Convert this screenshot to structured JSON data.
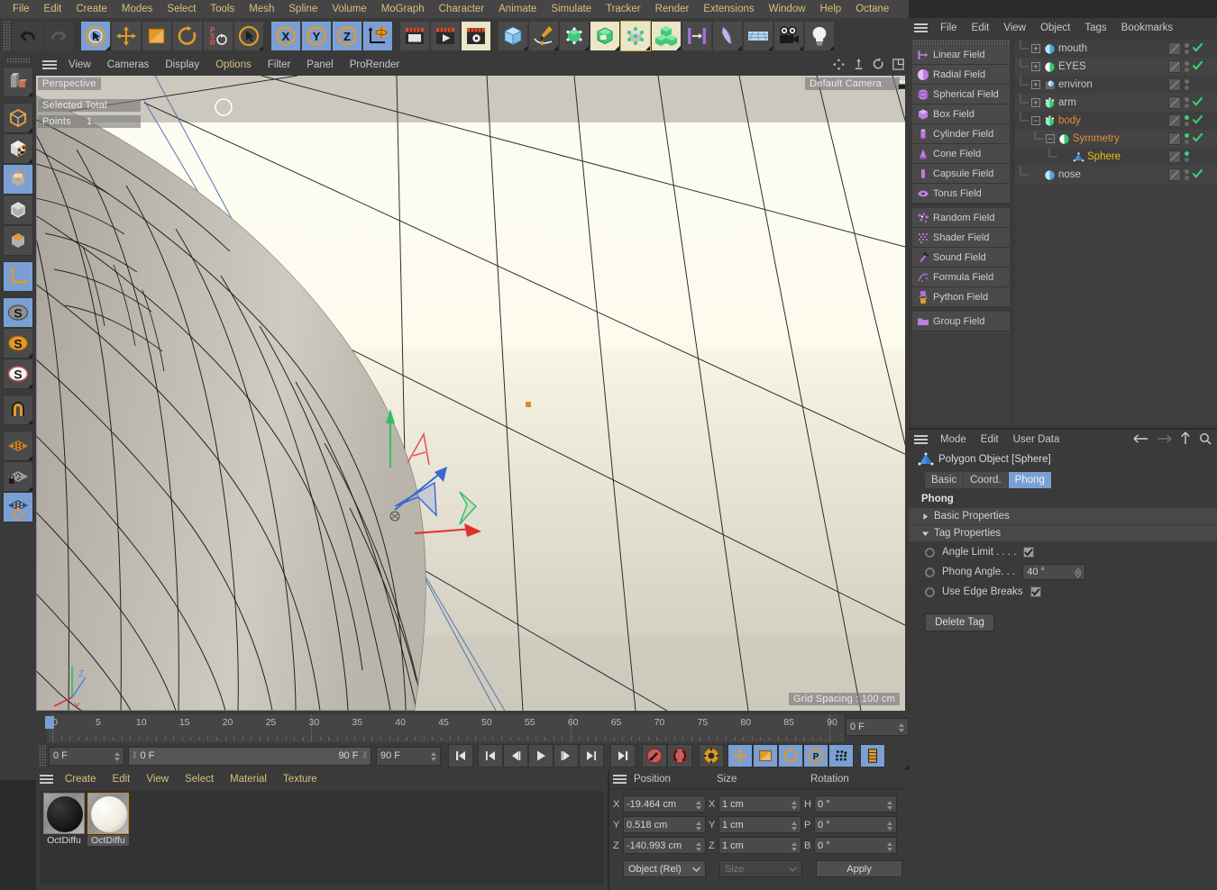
{
  "menubar": {
    "items": [
      "File",
      "Edit",
      "Create",
      "Modes",
      "Select",
      "Tools",
      "Mesh",
      "Spline",
      "Volume",
      "MoGraph",
      "Character",
      "Animate",
      "Simulate",
      "Tracker",
      "Render",
      "Extensions",
      "Window",
      "Help",
      "Octane"
    ]
  },
  "toolbar": {
    "undo": "undo-arrow",
    "redo": "redo-arrow",
    "tools": [
      "select-live-tool",
      "move-tool",
      "scale-tool",
      "rotate-tool",
      "psr-tool",
      "select-mode-tool"
    ],
    "axes": [
      "X",
      "Y",
      "Z"
    ],
    "world_label": "world-axis",
    "render_tools": [
      "render-view",
      "render-picture-viewer",
      "render-settings"
    ],
    "prim_tools": [
      "cube-primitive",
      "pen-spline",
      "subdivision-surface",
      "extrude-generator",
      "deformer",
      "array-cloner",
      "symmetry-tool",
      "bend-deformer",
      "floor-environment",
      "camera",
      "light"
    ]
  },
  "leftbar": {
    "items": [
      "make-editable",
      "model-mode",
      "texture-mode",
      "points-mode",
      "edges-mode",
      "polygons-mode",
      "axis-mode",
      "enable-snap-s1",
      "enable-snap-s2",
      "enable-snap-s3",
      "magnet-tool",
      "workplane",
      "lock-workplane",
      "workplane-rotate"
    ]
  },
  "viewport": {
    "menu": [
      "View",
      "Cameras",
      "Display",
      "Options",
      "Filter",
      "Panel",
      "ProRender"
    ],
    "menu_highlight": "Options",
    "perspective_label": "Perspective",
    "camera_label": "Default Camera",
    "hud_selected_total": "Selected Total",
    "hud_points_label": "Points",
    "hud_points_value": "1",
    "grid_spacing": "Grid Spacing : 100 cm",
    "axis_labels": {
      "x": "X",
      "y": "Y",
      "z": "Z"
    },
    "gizmo_axis_colors": {
      "x": "#e03a3a",
      "y": "#2fcc6e",
      "z": "#3a6fe0"
    },
    "background_top": "#fdfbf0",
    "background_bottom": "#cdc9be",
    "mesh_fill": "#b9b5ad"
  },
  "timeline": {
    "ticks": [
      0,
      5,
      10,
      15,
      20,
      25,
      30,
      35,
      40,
      45,
      50,
      55,
      60,
      65,
      70,
      75,
      80,
      85,
      90
    ],
    "current_frame_field": "0 F",
    "start_field": "0 F",
    "range_start": "0 F",
    "range_end": "90 F",
    "end_field": "90 F",
    "transport_buttons": [
      "go-to-start",
      "go-to-previous-key",
      "go-to-previous-frame",
      "play-forward",
      "go-to-next-frame",
      "go-to-next-key",
      "go-to-end",
      "record-active-objects",
      "autokeying",
      "keyframe-selection",
      "position-key",
      "scale-key",
      "rotation-key",
      "parameter-key",
      "point-level-animation",
      "timeline-toggle"
    ]
  },
  "material_manager": {
    "menu": [
      "Create",
      "Edit",
      "View",
      "Select",
      "Material",
      "Texture"
    ],
    "materials": [
      {
        "name": "OctDiffu",
        "color": "#171717",
        "selected": false
      },
      {
        "name": "OctDiffu",
        "color": "#eeeade",
        "selected": true
      }
    ]
  },
  "coordinates": {
    "headers": [
      "Position",
      "Size",
      "Rotation"
    ],
    "rows": [
      {
        "poslabel": "X",
        "posval": "-19.464 cm",
        "sizelabel": "X",
        "sizeval": "1 cm",
        "rotlabel": "H",
        "rotval": "0 °"
      },
      {
        "poslabel": "Y",
        "posval": "0.518 cm",
        "sizelabel": "Y",
        "sizeval": "1 cm",
        "rotlabel": "P",
        "rotval": "0 °"
      },
      {
        "poslabel": "Z",
        "posval": "-140.993 cm",
        "sizelabel": "Z",
        "sizeval": "1 cm",
        "rotlabel": "B",
        "rotval": "0 °"
      }
    ],
    "mode_select": "Object (Rel)",
    "size_select_placeholder": "Size",
    "apply_button": "Apply"
  },
  "object_manager": {
    "menu": [
      "File",
      "Edit",
      "View",
      "Object",
      "Tags",
      "Bookmarks"
    ],
    "fields": [
      {
        "label": "Linear Field",
        "icon": "linear-field-icon",
        "color": "#c07ede"
      },
      {
        "label": "Radial Field",
        "icon": "radial-field-icon",
        "color": "#c07ede"
      },
      {
        "label": "Spherical Field",
        "icon": "spherical-field-icon",
        "color": "#c07ede"
      },
      {
        "label": "Box Field",
        "icon": "box-field-icon",
        "color": "#c07ede"
      },
      {
        "label": "Cylinder Field",
        "icon": "cylinder-field-icon",
        "color": "#c07ede"
      },
      {
        "label": "Cone Field",
        "icon": "cone-field-icon",
        "color": "#c07ede"
      },
      {
        "label": "Capsule Field",
        "icon": "capsule-field-icon",
        "color": "#c07ede"
      },
      {
        "label": "Torus Field",
        "icon": "torus-field-icon",
        "color": "#c07ede"
      }
    ],
    "fields2": [
      {
        "label": "Random Field",
        "icon": "random-field-icon",
        "color": "#b06fd0"
      },
      {
        "label": "Shader Field",
        "icon": "shader-field-icon",
        "color": "#b06fd0"
      },
      {
        "label": "Sound Field",
        "icon": "sound-field-icon",
        "color": "#b06fd0"
      },
      {
        "label": "Formula Field",
        "icon": "formula-field-icon",
        "color": "#b06fd0"
      },
      {
        "label": "Python Field",
        "icon": "python-field-icon",
        "color": "#b06fd0"
      }
    ],
    "fields3": [
      {
        "label": "Group Field",
        "icon": "group-field-icon",
        "color": "#c07ede"
      }
    ],
    "tree": [
      {
        "name": "mouth",
        "depth": 0,
        "expander": "plus",
        "icon": "polygon-object-icon",
        "iconcolor": "#4aa8e0",
        "color": "#c8c8c8",
        "check": true,
        "dot": "gray",
        "tags": [
          "material-tag-dark"
        ]
      },
      {
        "name": "EYES",
        "depth": 0,
        "expander": "plus",
        "icon": "symmetry-icon",
        "iconcolor": "#2fcc6e",
        "color": "#c8c8c8",
        "check": true,
        "dot": "gray",
        "tags": []
      },
      {
        "name": "environ",
        "depth": 0,
        "expander": "plus",
        "icon": "null-object-icon",
        "iconcolor": "#7fbfe8",
        "color": "#c8c8c8",
        "check": false,
        "dot": "gray",
        "tags": []
      },
      {
        "name": "arm",
        "depth": 0,
        "expander": "plus",
        "icon": "point-object-icon",
        "iconcolor": "#2fcc6e",
        "color": "#c8c8c8",
        "check": true,
        "dot": "gray",
        "tags": []
      },
      {
        "name": "body",
        "depth": 0,
        "expander": "minus",
        "icon": "point-object-icon",
        "iconcolor": "#2fcc6e",
        "color": "#e08c3a",
        "check": true,
        "dot": "green",
        "tags": []
      },
      {
        "name": "Symmetry",
        "depth": 1,
        "expander": "minus",
        "icon": "symmetry-icon",
        "iconcolor": "#2fcc6e",
        "color": "#e08c3a",
        "check": true,
        "dot": "green",
        "tags": []
      },
      {
        "name": "Sphere",
        "depth": 2,
        "expander": "none",
        "icon": "polygon-tri-icon",
        "iconcolor": "#4a90e2",
        "color": "#e8c018",
        "check": false,
        "dot": "green",
        "tags": [
          "phong-tag",
          "checker-tag",
          "material-tag-light"
        ]
      },
      {
        "name": "nose",
        "depth": 0,
        "expander": "none",
        "icon": "polygon-object-icon",
        "iconcolor": "#4aa8e0",
        "color": "#c8c8c8",
        "check": true,
        "dot": "gray",
        "tags": [
          "material-tag-light"
        ]
      }
    ]
  },
  "attribute_manager": {
    "menu": [
      "Mode",
      "Edit",
      "User Data"
    ],
    "nav_icons": [
      "back-arrow-icon",
      "forward-arrow-icon",
      "up-arrow-icon",
      "search-icon"
    ],
    "object_title": "Polygon Object [Sphere]",
    "tabs": [
      "Basic",
      "Coord.",
      "Phong"
    ],
    "active_tab": "Phong",
    "section_title": "Phong",
    "folders": [
      {
        "label": "Basic Properties",
        "open": false
      },
      {
        "label": "Tag Properties",
        "open": true
      }
    ],
    "properties": [
      {
        "label": "Angle Limit . . . .",
        "type": "checkbox",
        "value": true
      },
      {
        "label": "Phong Angle. . .",
        "type": "number",
        "value": "40 °"
      },
      {
        "label": "Use Edge Breaks",
        "type": "checkbox",
        "value": true
      }
    ],
    "delete_button": "Delete Tag"
  }
}
